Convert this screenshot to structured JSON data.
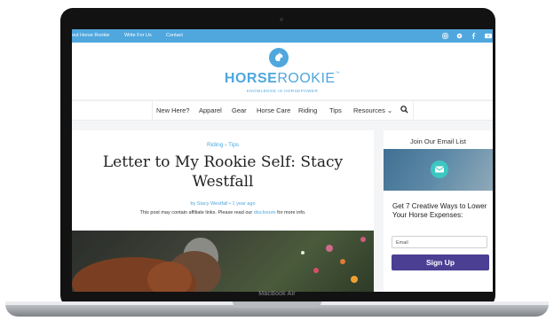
{
  "device": {
    "label": "MacBook Air"
  },
  "topbar": {
    "links": [
      "out Horse Rookie",
      "Write For Us",
      "Contact"
    ],
    "social_icons": [
      "instagram-icon",
      "pinterest-icon",
      "facebook-icon",
      "youtube-icon"
    ]
  },
  "brand": {
    "name_bold": "HORSE",
    "name_light": "ROOKIE",
    "trademark": "™",
    "tagline": "KNOWLEDGE IS HORSEPOWER",
    "accent": "#4fa7de"
  },
  "nav": {
    "items": [
      "New Here?",
      "Apparel",
      "Gear",
      "Horse Care",
      "Riding",
      "Tips",
      "Resources ⌄"
    ],
    "search_icon": "search-icon"
  },
  "article": {
    "category": "Riding › Tips",
    "title": "Letter to My Rookie Self: Stacy Westfall",
    "byline": "by Stacy Westfall • 1 year ago",
    "disclaimer_prefix": "This post may contain affiliate links. Please read our ",
    "disclaimer_link": "disclosure",
    "disclaimer_suffix": " for more info."
  },
  "sidebar": {
    "title": "Join Our Email List",
    "heading": "Get 7 Creative Ways to Lower Your Horse Expenses:",
    "email_placeholder": "Email",
    "button_label": "Sign Up",
    "button_color": "#4a3f93"
  }
}
